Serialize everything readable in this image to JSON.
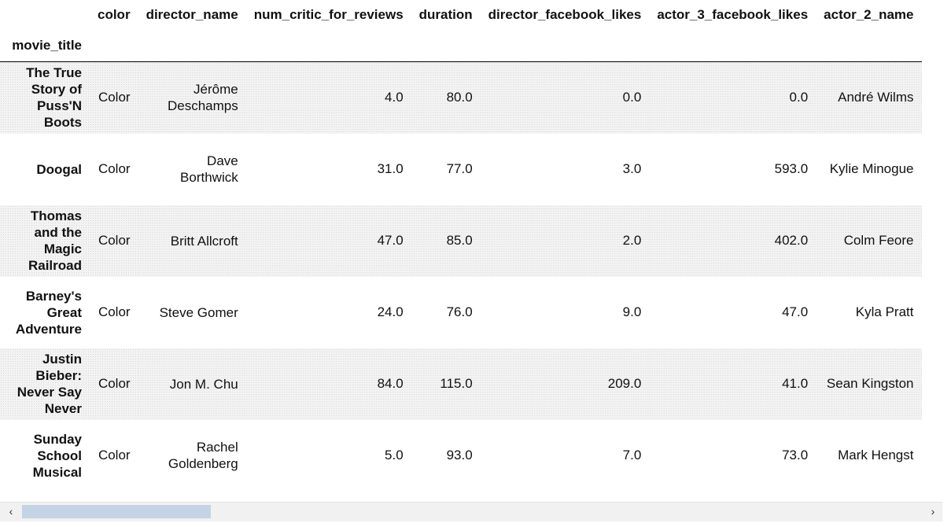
{
  "table": {
    "index_name": "movie_title",
    "columns": [
      "color",
      "director_name",
      "num_critic_for_reviews",
      "duration",
      "director_facebook_likes",
      "actor_3_facebook_likes",
      "actor_2_name"
    ],
    "rows": [
      {
        "index": "The True Story of Puss'N Boots",
        "cells": [
          "Color",
          "Jérôme Deschamps",
          "4.0",
          "80.0",
          "0.0",
          "0.0",
          "André Wilms"
        ]
      },
      {
        "index": "Doogal",
        "cells": [
          "Color",
          "Dave Borthwick",
          "31.0",
          "77.0",
          "3.0",
          "593.0",
          "Kylie Minogue"
        ]
      },
      {
        "index": "Thomas and the Magic Railroad",
        "cells": [
          "Color",
          "Britt Allcroft",
          "47.0",
          "85.0",
          "2.0",
          "402.0",
          "Colm Feore"
        ]
      },
      {
        "index": "Barney's Great Adventure",
        "cells": [
          "Color",
          "Steve Gomer",
          "24.0",
          "76.0",
          "9.0",
          "47.0",
          "Kyla Pratt"
        ]
      },
      {
        "index": "Justin Bieber: Never Say Never",
        "cells": [
          "Color",
          "Jon M. Chu",
          "84.0",
          "115.0",
          "209.0",
          "41.0",
          "Sean Kingston"
        ]
      },
      {
        "index": "Sunday School Musical",
        "cells": [
          "Color",
          "Rachel Goldenberg",
          "5.0",
          "93.0",
          "7.0",
          "73.0",
          "Mark Hengst"
        ]
      }
    ]
  },
  "scrollbar": {
    "left_arrow": "‹",
    "right_arrow": "›",
    "scroll_position": 0.0
  }
}
